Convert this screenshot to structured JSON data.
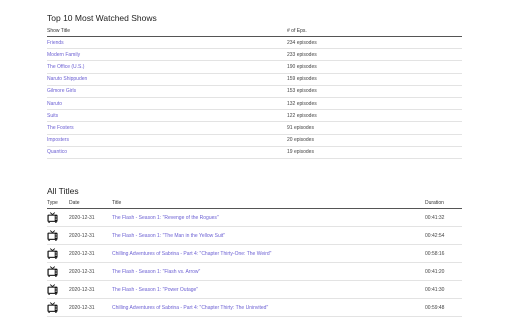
{
  "top_shows": {
    "heading": "Top 10 Most Watched Shows",
    "columns": [
      "Show Title",
      "# of Eps."
    ],
    "rows": [
      {
        "title": "Friends",
        "episodes": "234 episodes"
      },
      {
        "title": "Modern Family",
        "episodes": "233 episodes"
      },
      {
        "title": "The Office (U.S.)",
        "episodes": "190 episodes"
      },
      {
        "title": "Naruto Shippuden",
        "episodes": "159 episodes"
      },
      {
        "title": "Gilmore Girls",
        "episodes": "153 episodes"
      },
      {
        "title": "Naruto",
        "episodes": "132 episodes"
      },
      {
        "title": "Suits",
        "episodes": "122 episodes"
      },
      {
        "title": "The Fosters",
        "episodes": "91 episodes"
      },
      {
        "title": "Imposters",
        "episodes": "20 episodes"
      },
      {
        "title": "Quantico",
        "episodes": "19 episodes"
      }
    ]
  },
  "all_titles": {
    "heading": "All Titles",
    "columns": [
      "Type",
      "Date",
      "Title",
      "Duration"
    ],
    "rows": [
      {
        "type_icon": "tv-icon",
        "date": "2020-12-31",
        "title": "The Flash - Season 1: \"Revenge of the Rogues\"",
        "duration": "00:41:32"
      },
      {
        "type_icon": "tv-icon",
        "date": "2020-12-31",
        "title": "The Flash - Season 1: \"The Man in the Yellow Suit\"",
        "duration": "00:42:54"
      },
      {
        "type_icon": "tv-icon",
        "date": "2020-12-31",
        "title": "Chilling Adventures of Sabrina - Part 4: \"Chapter Thirty-One: The Weird\"",
        "duration": "00:58:16"
      },
      {
        "type_icon": "tv-icon",
        "date": "2020-12-31",
        "title": "The Flash - Season 1: \"Flash vs. Arrow\"",
        "duration": "00:41:20"
      },
      {
        "type_icon": "tv-icon",
        "date": "2020-12-31",
        "title": "The Flash - Season 1: \"Power Outage\"",
        "duration": "00:41:30"
      },
      {
        "type_icon": "tv-icon",
        "date": "2020-12-31",
        "title": "Chilling Adventures of Sabrina - Part 4: \"Chapter Thirty: The Uninvited\"",
        "duration": "00:59:48"
      }
    ]
  },
  "colors": {
    "link": "#6b5fd3",
    "text": "#222222",
    "rule": "#e3e3e3"
  }
}
